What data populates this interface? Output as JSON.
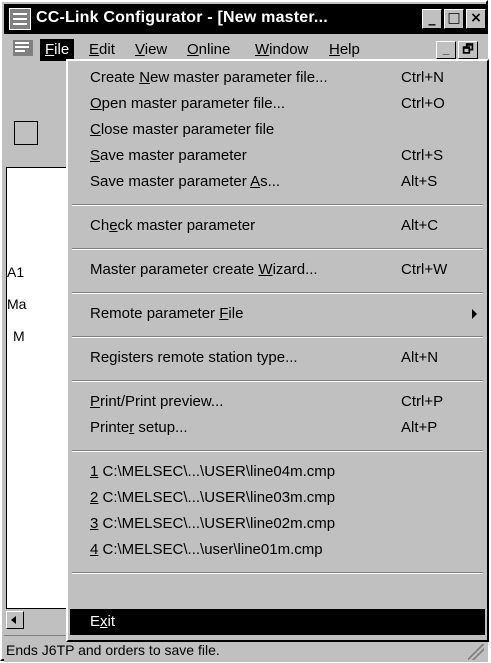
{
  "window": {
    "title": "CC-Link Configurator - [New master...",
    "minimize_symbol": "_",
    "maximize_symbol": "□",
    "close_symbol": "×",
    "icon": "cc-link-app-icon"
  },
  "menubar": {
    "items": [
      {
        "label": "File",
        "mnemonic": "F",
        "rest": "ile"
      },
      {
        "label": "Edit",
        "mnemonic": "E",
        "rest": "dit"
      },
      {
        "label": "View",
        "mnemonic": "V",
        "rest": "iew"
      },
      {
        "label": "Online",
        "mnemonic": "O",
        "rest": "nline"
      },
      {
        "label": "Window",
        "mnemonic": "W",
        "rest": "indow"
      },
      {
        "label": "Help",
        "mnemonic": "H",
        "rest": "elp"
      }
    ],
    "mdi_minimize": "_",
    "mdi_restore": "🗗"
  },
  "background": {
    "labels": [
      "A1",
      "Ma",
      "M"
    ]
  },
  "file_menu": {
    "items": [
      {
        "pre": "Create ",
        "u": "N",
        "post": "ew master parameter file...",
        "shortcut": "Ctrl+N"
      },
      {
        "pre": "",
        "u": "O",
        "post": "pen master parameter file...",
        "shortcut": "Ctrl+O"
      },
      {
        "pre": "",
        "u": "C",
        "post": "lose master parameter file",
        "shortcut": ""
      },
      {
        "pre": "",
        "u": "S",
        "post": "ave master parameter",
        "shortcut": "Ctrl+S"
      },
      {
        "pre": "Save master parameter ",
        "u": "A",
        "post": "s...",
        "shortcut": "Alt+S"
      },
      {
        "pre": "Ch",
        "u": "e",
        "post": "ck master parameter",
        "shortcut": "Alt+C"
      },
      {
        "pre": "Master parameter create ",
        "u": "W",
        "post": "izard...",
        "shortcut": "Ctrl+W"
      },
      {
        "pre": "Remote parameter ",
        "u": "F",
        "post": "ile",
        "shortcut": ""
      },
      {
        "pre": "Registers remote station type...",
        "u": "",
        "post": "",
        "shortcut": "Alt+N"
      },
      {
        "pre": "",
        "u": "P",
        "post": "rint/Print preview...",
        "shortcut": "Ctrl+P"
      },
      {
        "pre": "Printe",
        "u": "r",
        "post": " setup...",
        "shortcut": "Alt+P"
      },
      {
        "pre": "",
        "u": "1",
        "post": " C:\\MELSEC\\...\\USER\\line04m.cmp",
        "shortcut": ""
      },
      {
        "pre": "",
        "u": "2",
        "post": " C:\\MELSEC\\...\\USER\\line03m.cmp",
        "shortcut": ""
      },
      {
        "pre": "",
        "u": "3",
        "post": " C:\\MELSEC\\...\\USER\\line02m.cmp",
        "shortcut": ""
      },
      {
        "pre": "",
        "u": "4",
        "post": " C:\\MELSEC\\...\\user\\line01m.cmp",
        "shortcut": ""
      },
      {
        "pre": "E",
        "u": "x",
        "post": "it",
        "shortcut": ""
      }
    ]
  },
  "statusbar": {
    "text": "Ends J6TP and orders to save file."
  }
}
